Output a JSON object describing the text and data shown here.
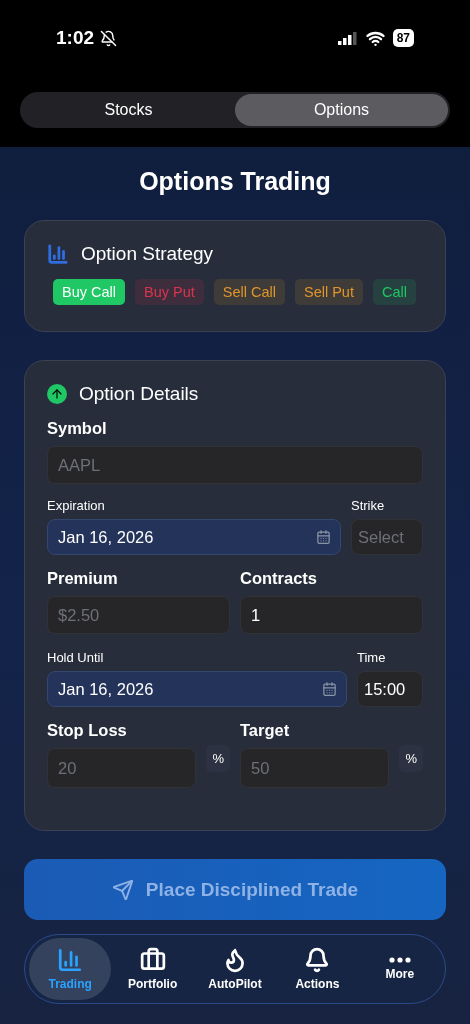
{
  "status_bar": {
    "time": "1:02",
    "battery": "87"
  },
  "segments": [
    {
      "label": "Stocks",
      "selected": false
    },
    {
      "label": "Options",
      "selected": true
    }
  ],
  "title": "Options Trading",
  "strategy": {
    "heading": "Option Strategy",
    "chips": [
      {
        "label": "Buy Call",
        "selected": true,
        "color": "#1fc765"
      },
      {
        "label": "Buy Put",
        "selected": false,
        "color": "#d9344e"
      },
      {
        "label": "Sell Call",
        "selected": false,
        "color": "#e0962a"
      },
      {
        "label": "Sell Put",
        "selected": false,
        "color": "#e0962a"
      },
      {
        "label": "Call",
        "selected": false,
        "color": "#1fc765"
      }
    ]
  },
  "details": {
    "heading": "Option Details",
    "symbol": {
      "label": "Symbol",
      "placeholder": "AAPL"
    },
    "expiration": {
      "label": "Expiration",
      "value": "Jan 16, 2026"
    },
    "strike": {
      "label": "Strike",
      "placeholder": "Select"
    },
    "premium": {
      "label": "Premium",
      "placeholder": "$2.50"
    },
    "contracts": {
      "label": "Contracts",
      "value": "1"
    },
    "hold_until": {
      "label": "Hold Until",
      "value": "Jan 16, 2026"
    },
    "time": {
      "label": "Time",
      "value": "15:00"
    },
    "stop_loss": {
      "label": "Stop Loss",
      "placeholder": "20",
      "unit": "%"
    },
    "target": {
      "label": "Target",
      "placeholder": "50",
      "unit": "%"
    }
  },
  "submit": {
    "label": "Place Disciplined Trade",
    "disabled": true
  },
  "nav": [
    {
      "label": "Trading",
      "selected": true
    },
    {
      "label": "Portfolio",
      "selected": false
    },
    {
      "label": "AutoPilot",
      "selected": false
    },
    {
      "label": "Actions",
      "selected": false
    },
    {
      "label": "More",
      "selected": false
    }
  ]
}
